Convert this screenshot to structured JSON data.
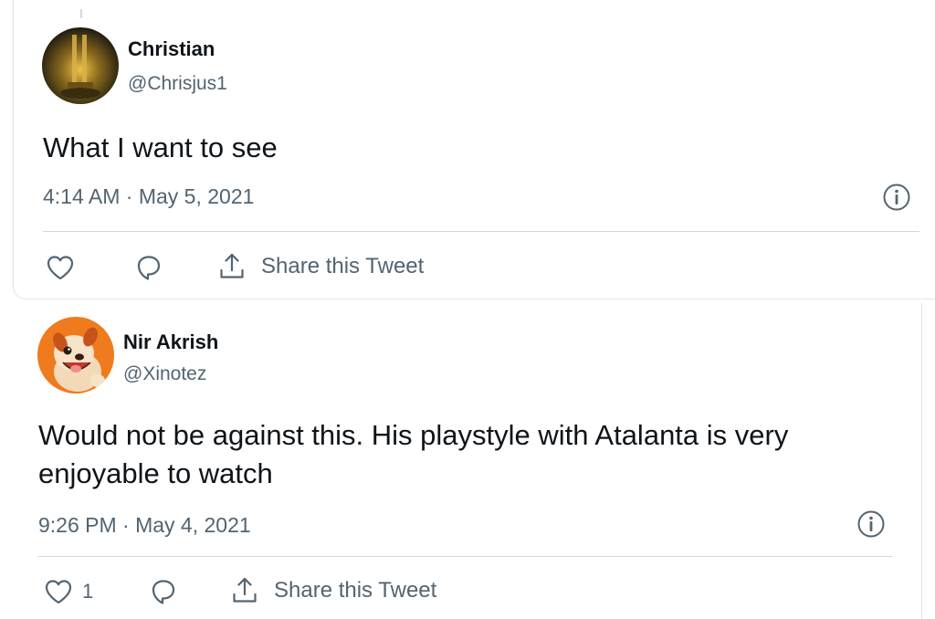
{
  "tweets": [
    {
      "name": "Christian",
      "handle": "@Chrisjus1",
      "text": "What I want to see",
      "timestamp": "4:14 AM · May 5, 2021",
      "like_count": "",
      "share_label": "Share this Tweet",
      "avatar": "lantern-photo"
    },
    {
      "name": "Nir Akrish",
      "handle": "@Xinotez",
      "text": "Would not be against this. His playstyle with Atalanta is very enjoyable to watch",
      "timestamp": "9:26 PM · May 4, 2021",
      "like_count": "1",
      "share_label": "Share this Tweet",
      "avatar": "cartoon-dog"
    }
  ],
  "icons": {
    "like": "heart-icon",
    "reply": "reply-bubble-icon",
    "share": "share-icon",
    "info": "info-icon"
  },
  "colors": {
    "text": "#0f1419",
    "secondary": "#536471",
    "border": "#cfd9de"
  }
}
